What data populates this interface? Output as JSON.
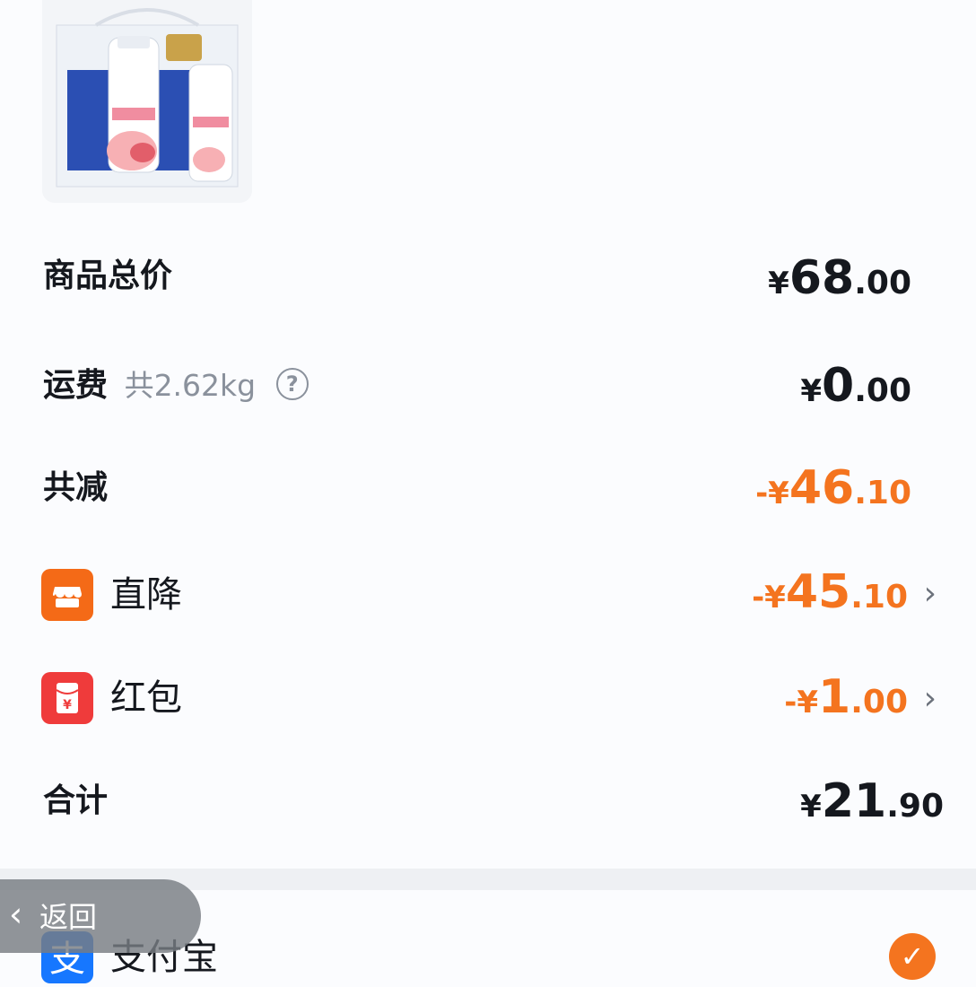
{
  "summary": {
    "total_goods": {
      "label": "商品总价",
      "currency": "¥",
      "int": "68",
      "dec": ".00"
    },
    "shipping": {
      "label": "运费",
      "weight": "共2.62kg",
      "currency": "¥",
      "int": "0",
      "dec": ".00"
    },
    "total_discount": {
      "label": "共减",
      "prefix": "-¥",
      "int": "46",
      "dec": ".10"
    },
    "direct_discount": {
      "label": "直降",
      "prefix": "-¥",
      "int": "45",
      "dec": ".10"
    },
    "red_packet": {
      "label": "红包",
      "prefix": "-¥",
      "int": "1",
      "dec": ".00"
    },
    "grand_total": {
      "label": "合计",
      "currency": "¥",
      "int": "21",
      "dec": ".90"
    }
  },
  "payment": {
    "method_label": "支付宝"
  },
  "nav": {
    "back_label": "返回"
  },
  "colors": {
    "accent_orange": "#f4741f",
    "red_packet_red": "#ef3b3b",
    "alipay_blue": "#1677ff"
  },
  "icons": {
    "help": "question-circle-icon",
    "direct_discount": "store-icon",
    "red_packet": "red-packet-icon",
    "chevron": "chevron-right-icon",
    "alipay": "alipay-icon",
    "check": "check-circle-icon",
    "back": "chevron-left-icon"
  }
}
